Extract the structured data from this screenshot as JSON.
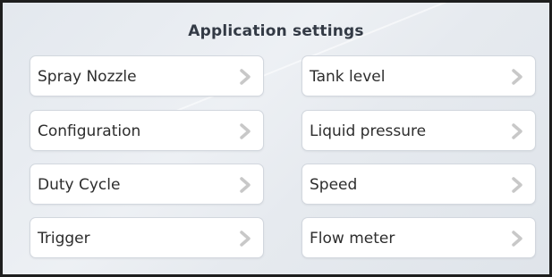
{
  "header": {
    "title": "Application settings"
  },
  "settings": {
    "left": [
      {
        "label": "Spray Nozzle",
        "icon": "chevron-right-icon"
      },
      {
        "label": "Configuration",
        "icon": "chevron-right-icon"
      },
      {
        "label": "Duty Cycle",
        "icon": "chevron-right-icon"
      },
      {
        "label": "Trigger",
        "icon": "chevron-right-icon"
      }
    ],
    "right": [
      {
        "label": "Tank level",
        "icon": "chevron-right-icon"
      },
      {
        "label": "Liquid pressure",
        "icon": "chevron-right-icon"
      },
      {
        "label": "Speed",
        "icon": "chevron-right-icon"
      },
      {
        "label": "Flow meter",
        "icon": "chevron-right-icon"
      }
    ]
  },
  "colors": {
    "border": "#1e1e1e",
    "background": "#e6eaef",
    "button": "#ffffff",
    "chevron": "#c8c8c8"
  }
}
